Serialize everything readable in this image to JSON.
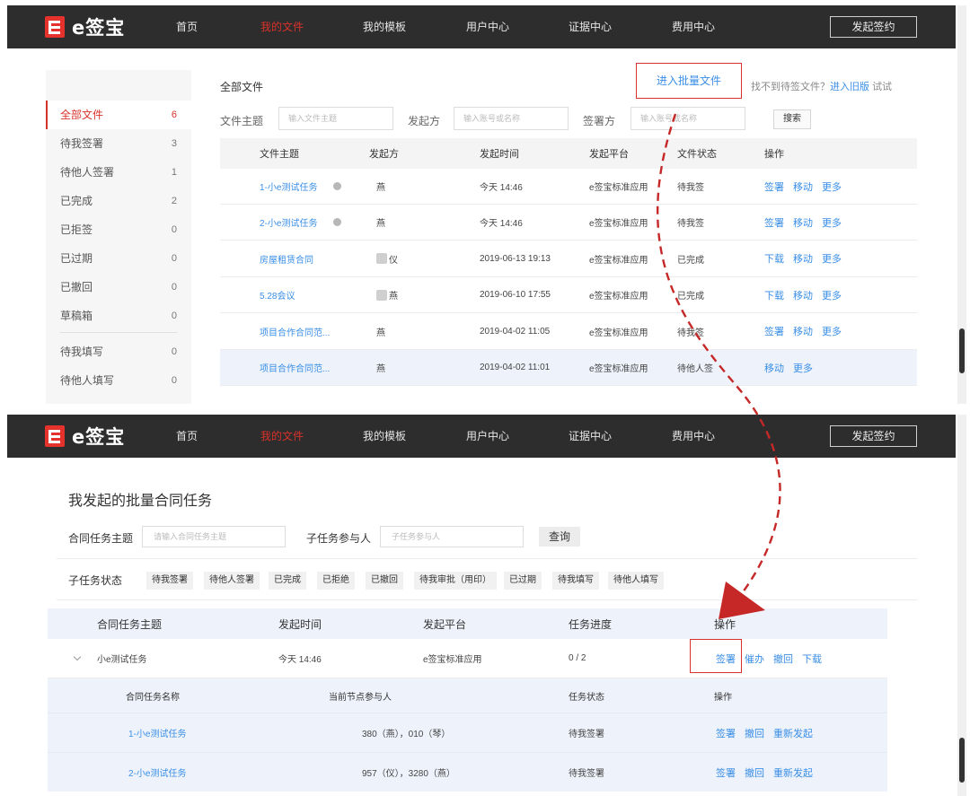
{
  "brand": {
    "name": "e签宝"
  },
  "nav": [
    "首页",
    "我的文件",
    "我的模板",
    "用户中心",
    "证据中心",
    "费用中心"
  ],
  "nav_active": "我的文件",
  "launch_button": "发起签约",
  "screen1": {
    "sidebar": [
      {
        "label": "全部文件",
        "count": "6",
        "active": true
      },
      {
        "label": "待我签署",
        "count": "3"
      },
      {
        "label": "待他人签署",
        "count": "1"
      },
      {
        "label": "已完成",
        "count": "2"
      },
      {
        "label": "已拒签",
        "count": "0"
      },
      {
        "label": "已过期",
        "count": "0"
      },
      {
        "label": "已撤回",
        "count": "0"
      },
      {
        "label": "草稿箱",
        "count": "0"
      },
      {
        "label": "待我填写",
        "count": "0"
      },
      {
        "label": "待他人填写",
        "count": "0"
      }
    ],
    "breadcrumb": "全部文件",
    "batch_link": "进入批量文件",
    "hint_text": "找不到待签文件？",
    "hint_link": "进入旧版",
    "hint_try": "试试",
    "filters": {
      "subject_label": "文件主题",
      "subject_placeholder": "输入文件主题",
      "initiator_label": "发起方",
      "initiator_placeholder": "输入账号或名称",
      "signer_label": "签署方",
      "signer_placeholder": "输入账号或名称",
      "search_button": "搜索"
    },
    "table": {
      "headers": [
        "文件主题",
        "发起方",
        "发起时间",
        "发起平台",
        "文件状态",
        "操作"
      ],
      "rows": [
        {
          "subject": "1-小e测试任务",
          "info": true,
          "initiator": "燕",
          "time": "今天 14:46",
          "platform": "e签宝标准应用",
          "status": "待我签",
          "ops": [
            "签署",
            "移动",
            "更多"
          ]
        },
        {
          "subject": "2-小e测试任务",
          "info": true,
          "initiator": "燕",
          "time": "今天 14:46",
          "platform": "e签宝标准应用",
          "status": "待我签",
          "ops": [
            "签署",
            "移动",
            "更多"
          ]
        },
        {
          "subject": "房屋租赁合同",
          "initiator": "仪",
          "blur": true,
          "time": "2019-06-13 19:13",
          "platform": "e签宝标准应用",
          "status": "已完成",
          "ops": [
            "下载",
            "移动",
            "更多"
          ]
        },
        {
          "subject": "5.28会议",
          "initiator": "燕",
          "blur": true,
          "time": "2019-06-10 17:55",
          "platform": "e签宝标准应用",
          "status": "已完成",
          "ops": [
            "下载",
            "移动",
            "更多"
          ]
        },
        {
          "subject": "项目合作合同范...",
          "initiator": "燕",
          "time": "2019-04-02 11:05",
          "platform": "e签宝标准应用",
          "status": "待我签",
          "ops": [
            "签署",
            "移动",
            "更多"
          ]
        },
        {
          "subject": "项目合作合同范...",
          "initiator": "燕",
          "time": "2019-04-02 11:01",
          "platform": "e签宝标准应用",
          "status": "待他人签",
          "ops": [
            "移动",
            "更多"
          ]
        }
      ]
    }
  },
  "screen2": {
    "title": "我发起的批量合同任务",
    "filters": {
      "subject_label": "合同任务主题",
      "subject_placeholder": "请输入合同任务主题",
      "participant_label": "子任务参与人",
      "participant_placeholder": "子任务参与人",
      "query_button": "查询"
    },
    "status_label": "子任务状态",
    "status_chips": [
      "待我签署",
      "待他人签署",
      "已完成",
      "已拒绝",
      "已撤回",
      "待我审批（用印）",
      "已过期",
      "待我填写",
      "待他人填写"
    ],
    "table_headers": [
      "合同任务主题",
      "发起时间",
      "发起平台",
      "任务进度",
      "操作"
    ],
    "task": {
      "subject": "小e测试任务",
      "time": "今天 14:46",
      "platform": "e签宝标准应用",
      "progress": "0 / 2",
      "ops": [
        "签署",
        "催办",
        "撤回",
        "下载"
      ]
    },
    "sub_headers": [
      "合同任务名称",
      "当前节点参与人",
      "任务状态",
      "操作"
    ],
    "sub_rows": [
      {
        "name": "1-小e测试任务",
        "participants": "380（燕），010（琴）",
        "status": "待我签署",
        "ops": [
          "签署",
          "撤回",
          "重新发起"
        ]
      },
      {
        "name": "2-小e测试任务",
        "participants": "957（仪），3280（燕）",
        "status": "待我签署",
        "ops": [
          "签署",
          "撤回",
          "重新发起"
        ]
      }
    ]
  },
  "colors": {
    "accent": "#d9312b",
    "link": "#3a8ee6",
    "topbar": "#2d2d2d"
  }
}
